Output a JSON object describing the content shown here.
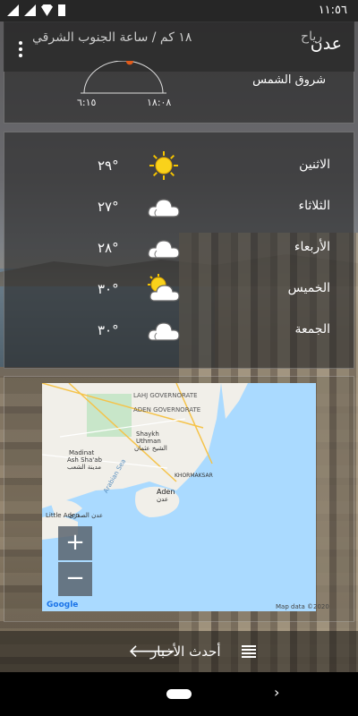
{
  "status_bar": {
    "time": "١١:٥٦"
  },
  "header": {
    "city": "عدن",
    "wind_label": "رياح",
    "wind_value": "١٨ كم / ساعة الجنوب الشرقي"
  },
  "sun": {
    "label": "شروق الشمس",
    "sunrise": "٦:١٥",
    "sunset": "١٨:٠٨",
    "sun_position_fraction": 0.55
  },
  "forecast": [
    {
      "day": "الاثنين",
      "temp": "٢٩°",
      "icon": "sun-icon"
    },
    {
      "day": "الثلاثاء",
      "temp": "٢٧°",
      "icon": "cloud-icon"
    },
    {
      "day": "الأربعاء",
      "temp": "٢٨°",
      "icon": "cloud-icon"
    },
    {
      "day": "الخميس",
      "temp": "٣٠°",
      "icon": "partly-cloudy-icon"
    },
    {
      "day": "الجمعة",
      "temp": "٣٠°",
      "icon": "cloud-icon"
    }
  ],
  "map": {
    "zoom_in": "+",
    "zoom_out": "−",
    "google": "Google",
    "attribution": "Map data ©2020",
    "labels": {
      "lahj": "LAHJ GOVERNORATE",
      "aden_gov": "ADEN GOVERNORATE",
      "shaykh": "Shaykh",
      "uthman": "Uthman",
      "shaykh_ar": "الشيخ عثمان",
      "madinat": "Madinat",
      "ash_shab": "Ash Sha'ab",
      "shab_ar": "مدينة الشعب",
      "khormaksar": "KHORMAKSAR",
      "aden": "Aden",
      "aden_ar": "عدن",
      "little_aden": "Little Aden",
      "little_aden_ar": "عدن الصغرى",
      "sea": "Arabian Sea"
    }
  },
  "news": {
    "label": "أحدث الأخبار"
  }
}
